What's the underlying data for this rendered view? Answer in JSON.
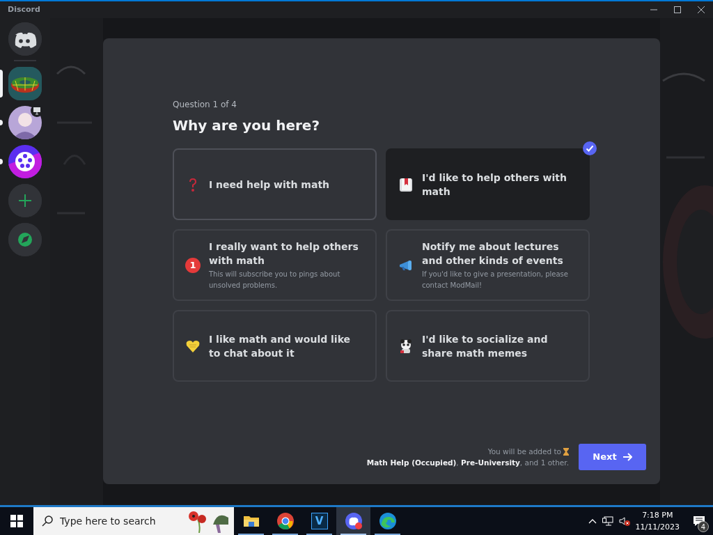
{
  "window": {
    "title": "Discord"
  },
  "servers": [
    {
      "kind": "home",
      "selected": false
    },
    {
      "kind": "torus",
      "selected": true
    },
    {
      "kind": "avatar",
      "selected": false,
      "unread": true,
      "streaming": true
    },
    {
      "kind": "film",
      "selected": false,
      "unread": true
    },
    {
      "kind": "add",
      "selected": false
    },
    {
      "kind": "explore",
      "selected": false
    }
  ],
  "onboarding": {
    "counter": "Question 1 of 4",
    "title": "Why are you here?",
    "options": [
      {
        "label": "I need help with math",
        "selected": false
      },
      {
        "label": "I'd like to help others with math",
        "selected": true
      },
      {
        "label": "I really want to help others with math",
        "description": "This will subscribe you to pings about unsolved problems.",
        "badge": "1",
        "selected": false
      },
      {
        "label": "Notify me about lectures and other kinds of events",
        "description": "If you'd like to give a presentation, please contact ModMail!",
        "selected": false
      },
      {
        "label": "I like math and would like to chat about it",
        "selected": false
      },
      {
        "label": "I'd like to socialize and share math memes",
        "selected": false
      }
    ],
    "note_prefix": "You will be added to",
    "note_rest": "**Math Help (Occupied)**, **Pre-University**, and 1 other.",
    "next_button": "Next"
  },
  "taskbar": {
    "search_placeholder": "Type here to search",
    "apps": [
      {
        "kind": "folder",
        "active": false
      },
      {
        "kind": "chrome",
        "active": false
      },
      {
        "kind": "v",
        "label": "V",
        "active": false
      },
      {
        "kind": "discord",
        "active": true
      },
      {
        "kind": "edge",
        "active": false
      }
    ],
    "time": "7:18 PM",
    "date": "11/11/2023",
    "notifications": "4"
  }
}
